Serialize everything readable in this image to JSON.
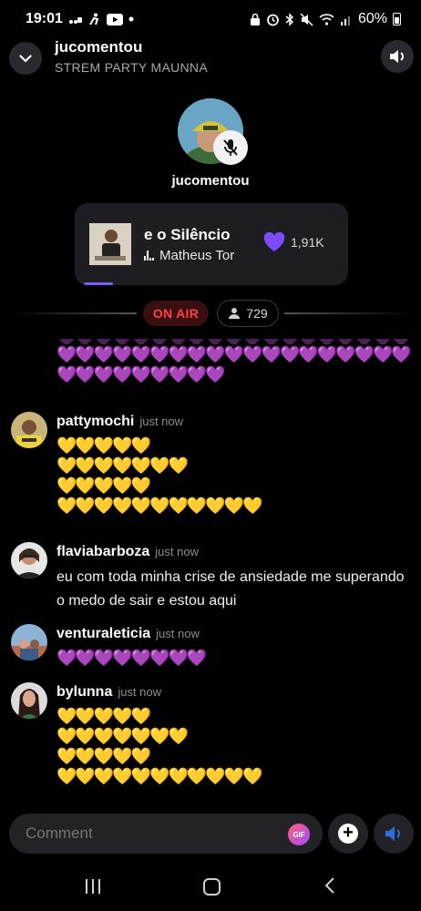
{
  "status_bar": {
    "time": "19:01",
    "battery": "60%",
    "left_icons": [
      "cast-icon",
      "accessibility-icon",
      "youtube-icon",
      "dot-icon"
    ],
    "right_icons": [
      "alarm-icon",
      "bluetooth-icon",
      "mute-icon",
      "wifi-icon",
      "signal-icon",
      "battery-icon"
    ]
  },
  "header": {
    "host": "jucomentou",
    "room": "STREM PARTY MAUNNA"
  },
  "speaker": {
    "name": "jucomentou",
    "muted": true
  },
  "now_playing": {
    "title": "e o Silêncio",
    "artist": "Matheus Tor",
    "likes": "1,91K",
    "heart_color": "#7c4dff"
  },
  "live": {
    "on_air_label": "ON AIR",
    "viewers": "729",
    "on_air_color": "#ff4040"
  },
  "chat": {
    "top_hearts": [
      "💜💜💜💜💜💜💜💜💜💜💜💜💜💜💜💜💜💜💜",
      "💜💜💜💜💜💜💜💜💜"
    ],
    "messages": [
      {
        "user": "pattymochi",
        "time": "just now",
        "lines": [
          "💛💛💛💛💛",
          "💛💛💛💛💛💛💛",
          "💛💛💛💛💛",
          "💛💛💛💛💛💛💛💛💛💛💛"
        ]
      },
      {
        "user": "flaviabarboza",
        "time": "just now",
        "text": "eu com toda minha crise de ansiedade me superando o medo de sair e estou aqui"
      },
      {
        "user": "venturaleticia",
        "time": "just now",
        "lines": [
          "💜💜💜💜💜💜💜💜"
        ]
      },
      {
        "user": "bylunna",
        "time": "just now",
        "lines": [
          "💛💛💛💛💛",
          "💛💛💛💛💛💛💛",
          "💛💛💛💛💛",
          "💛💛💛💛💛💛💛💛💛💛💛"
        ]
      }
    ]
  },
  "composer": {
    "placeholder": "Comment",
    "gif_label": "GIF"
  }
}
